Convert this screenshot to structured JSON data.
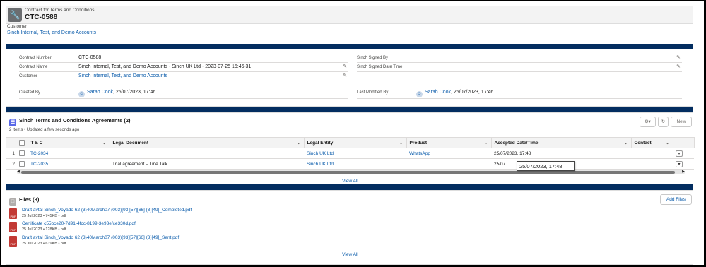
{
  "header": {
    "object_label": "Contract for Terms and Conditions",
    "record_name": "CTC-0588",
    "customer_label": "Customer",
    "customer_value": "Sinch Internal, Test, and Demo Accounts"
  },
  "details": {
    "contract_number_label": "Contract Number",
    "contract_number_value": "CTC-0588",
    "contract_name_label": "Contract Name",
    "contract_name_value": "Sinch Internal, Test, and Demo Accounts - Sinch UK Ltd - 2023-07-25 15:46:31",
    "customer_label": "Customer",
    "customer_value": "Sinch Internal, Test, and Demo Accounts",
    "created_by_label": "Created By",
    "created_by_user": "Sarah Cook",
    "created_by_date": ", 25/07/2023, 17:46",
    "signed_by_label": "Sinch Signed By",
    "signed_date_label": "Sinch Signed Date Time",
    "modified_by_label": "Last Modified By",
    "modified_by_user": "Sarah Cook",
    "modified_by_date": ", 25/07/2023, 17:46"
  },
  "agreements": {
    "title": "Sinch Terms and Conditions Agreements (2)",
    "subtitle": "2 items • Updated a few seconds ago",
    "new_label": "New",
    "columns": [
      "T & C",
      "Legal Document",
      "Legal Entity",
      "Product",
      "Accepted Date/Time",
      "Contact"
    ],
    "rows": [
      {
        "num": "1",
        "tc": "TC-2034",
        "doc": "",
        "entity": "Sinch UK Ltd",
        "product": "WhatsApp",
        "accepted": "25/07/2023, 17:48",
        "contact": ""
      },
      {
        "num": "2",
        "tc": "TC-2035",
        "doc": "Trial agreement – Line Talk",
        "entity": "Sinch UK Ltd",
        "product": "",
        "accepted": "25/07",
        "contact": ""
      }
    ],
    "tooltip": "25/07/2023, 17:48",
    "view_all": "View All"
  },
  "files": {
    "title": "Files (3)",
    "add_label": "Add Files",
    "items": [
      {
        "name": "Draft avtal Sinch_Voyado 62 (3)40March07 (003)[93][57][66] (3)[49]_Completed.pdf",
        "meta": "25 Jul 2023 • 745KB • pdf"
      },
      {
        "name": "Certificate c55bce20-7d91-4fcc-8199-3e93efce330d.pdf",
        "meta": "25 Jul 2023 • 128KB • pdf"
      },
      {
        "name": "Draft avtal Sinch_Voyado 62 (3)40March07 (003)[93][57][66] (3)[49]_Sent.pdf",
        "meta": "25 Jul 2023 • 619KB • pdf"
      }
    ],
    "pdf_label": "PDF",
    "view_all": "View All"
  },
  "icons": {
    "header": "wrench-icon",
    "agreements": "list-icon",
    "files": "file-icon",
    "edit": "pencil-icon",
    "settings": "gear-icon",
    "refresh": "refresh-icon"
  },
  "colors": {
    "link": "#0b5cab",
    "band": "#032d60",
    "pdf": "#c23934",
    "agreements_icon": "#5867e8"
  }
}
